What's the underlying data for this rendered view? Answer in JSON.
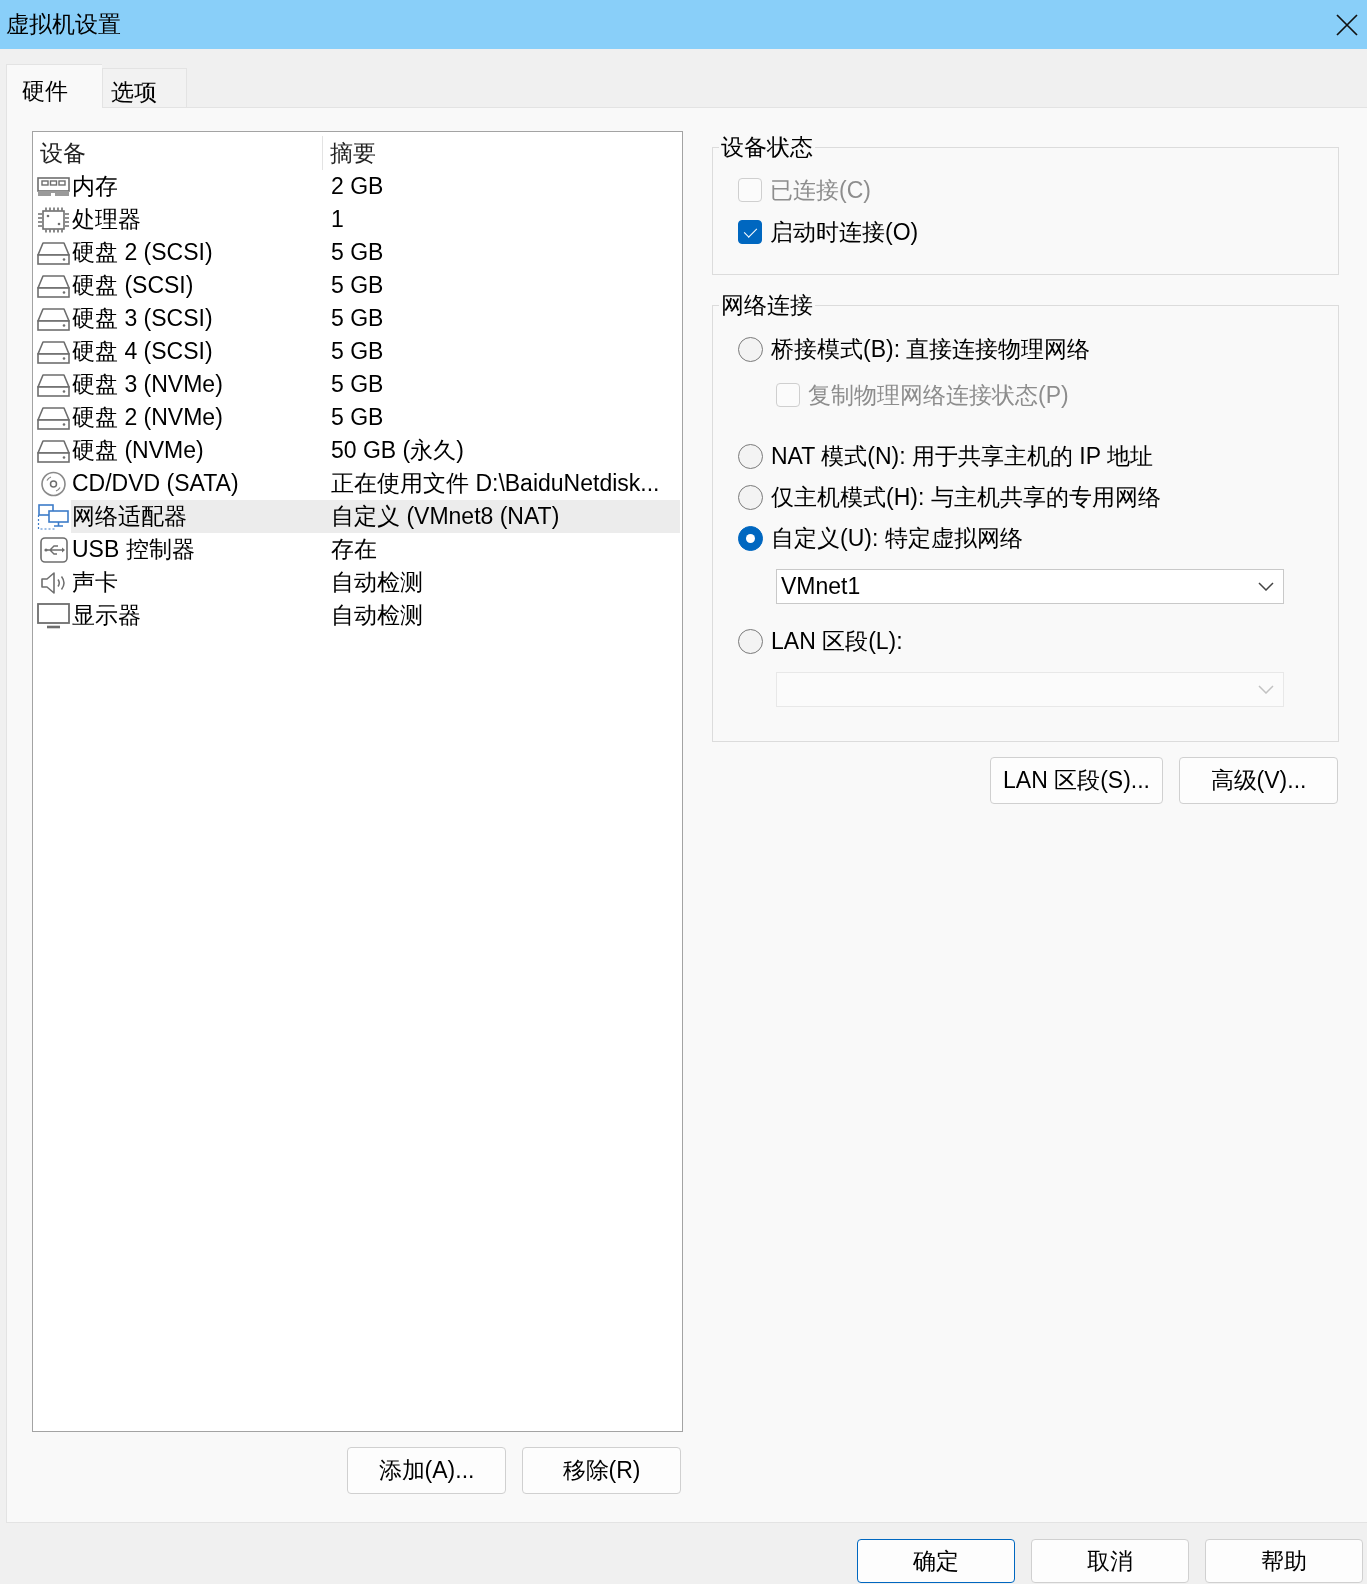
{
  "window": {
    "title": "虚拟机设置"
  },
  "tabs": [
    {
      "label": "硬件",
      "selected": true
    },
    {
      "label": "选项",
      "selected": false
    }
  ],
  "device_list": {
    "columns": [
      "设备",
      "摘要"
    ],
    "rows": [
      {
        "kind": "memory",
        "device": "内存",
        "summary": "2 GB",
        "selected": false
      },
      {
        "kind": "processor",
        "device": "处理器",
        "summary": "1",
        "selected": false
      },
      {
        "kind": "disk",
        "device": "硬盘 2 (SCSI)",
        "summary": "5 GB",
        "selected": false
      },
      {
        "kind": "disk",
        "device": "硬盘 (SCSI)",
        "summary": "5 GB",
        "selected": false
      },
      {
        "kind": "disk",
        "device": "硬盘 3 (SCSI)",
        "summary": "5 GB",
        "selected": false
      },
      {
        "kind": "disk",
        "device": "硬盘 4 (SCSI)",
        "summary": "5 GB",
        "selected": false
      },
      {
        "kind": "disk",
        "device": "硬盘 3 (NVMe)",
        "summary": "5 GB",
        "selected": false
      },
      {
        "kind": "disk",
        "device": "硬盘 2 (NVMe)",
        "summary": "5 GB",
        "selected": false
      },
      {
        "kind": "disk",
        "device": "硬盘 (NVMe)",
        "summary": "50 GB (永久)",
        "selected": false
      },
      {
        "kind": "cdrom",
        "device": "CD/DVD (SATA)",
        "summary": "正在使用文件 D:\\BaiduNetdisk...",
        "selected": false
      },
      {
        "kind": "network",
        "device": "网络适配器",
        "summary": "自定义 (VMnet8 (NAT)",
        "selected": true
      },
      {
        "kind": "usb",
        "device": "USB 控制器",
        "summary": "存在",
        "selected": false
      },
      {
        "kind": "sound",
        "device": "声卡",
        "summary": "自动检测",
        "selected": false
      },
      {
        "kind": "display",
        "device": "显示器",
        "summary": "自动检测",
        "selected": false
      }
    ]
  },
  "list_buttons": [
    "添加(A)...",
    "移除(R)"
  ],
  "device_status": {
    "title": "设备状态",
    "options": [
      {
        "label": "已连接(C)",
        "checked": false,
        "disabled": true
      },
      {
        "label": "启动时连接(O)",
        "checked": true,
        "disabled": false
      }
    ]
  },
  "network_connection": {
    "title": "网络连接",
    "modes": [
      {
        "label": "桥接模式(B): 直接连接物理网络",
        "selected": false,
        "option": {
          "label": "复制物理网络连接状态(P)",
          "checked": false,
          "disabled": true
        }
      },
      {
        "label": "NAT 模式(N): 用于共享主机的 IP 地址",
        "selected": false
      },
      {
        "label": "仅主机模式(H): 与主机共享的专用网络",
        "selected": false
      },
      {
        "label": "自定义(U): 特定虚拟网络",
        "selected": true,
        "dropdown": {
          "value": "VMnet1",
          "disabled": false
        }
      },
      {
        "label": "LAN 区段(L):",
        "selected": false,
        "dropdown": {
          "disabled": true
        }
      }
    ]
  },
  "network_buttons": [
    "LAN 区段(S)...",
    "高级(V)..."
  ],
  "dialog_buttons": [
    {
      "label": "确定",
      "default": true
    },
    {
      "label": "取消",
      "default": false
    },
    {
      "label": "帮助",
      "default": false
    }
  ]
}
